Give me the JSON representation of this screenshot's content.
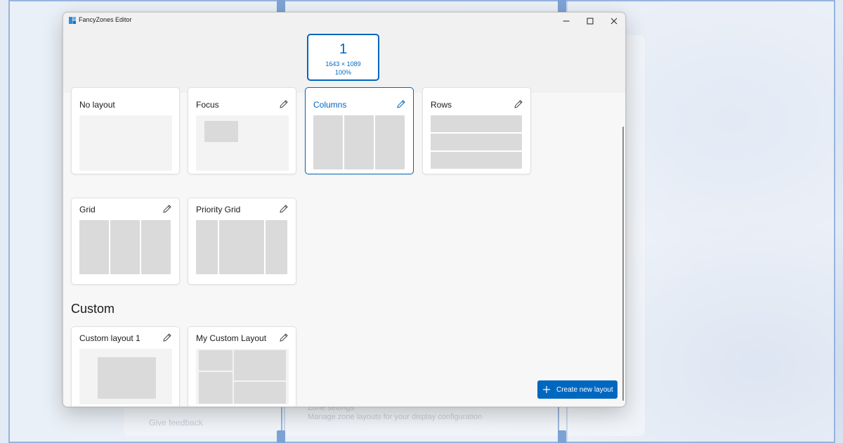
{
  "window": {
    "title": "FancyZones Editor"
  },
  "monitor": {
    "number": "1",
    "resolution": "1643 × 1089",
    "scale": "100%"
  },
  "templates": [
    {
      "name": "No layout",
      "editable": false,
      "selected": false
    },
    {
      "name": "Focus",
      "editable": true,
      "selected": false
    },
    {
      "name": "Columns",
      "editable": true,
      "selected": true
    },
    {
      "name": "Rows",
      "editable": true,
      "selected": false
    },
    {
      "name": "Grid",
      "editable": true,
      "selected": false
    },
    {
      "name": "Priority Grid",
      "editable": true,
      "selected": false
    }
  ],
  "custom": {
    "section_title": "Custom",
    "layouts": [
      {
        "name": "Custom layout 1",
        "editable": true
      },
      {
        "name": "My Custom Layout",
        "editable": true
      }
    ]
  },
  "actions": {
    "create_new_layout": "Create new layout"
  },
  "background": {
    "feedback_text": "Give feedback",
    "sub_line_1": "Zone settings",
    "sub_line_2": "Manage zone layouts for your display configuration"
  },
  "icons": {
    "app": "fancyzones-icon",
    "edit": "pencil-icon",
    "add": "plus-icon"
  },
  "colors": {
    "accent": "#0067c0",
    "zone_fill": "#dadada",
    "preview_bg": "#f3f3f3"
  }
}
